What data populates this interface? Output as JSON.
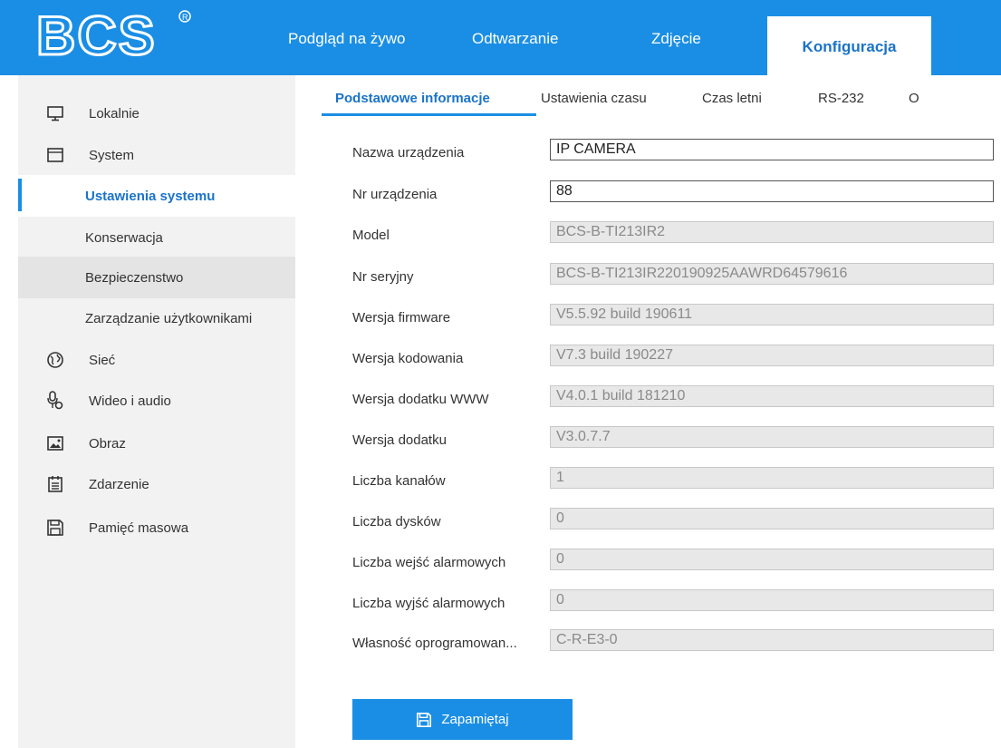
{
  "brand": {
    "logo_text": "BCS"
  },
  "nav": {
    "items": [
      "Podgląd na żywo",
      "Odtwarzanie",
      "Zdjęcie",
      "Konfiguracja"
    ],
    "active": "Konfiguracja"
  },
  "sidebar": {
    "items": [
      {
        "label": "Lokalnie",
        "icon": "monitor-icon"
      },
      {
        "label": "System",
        "icon": "system-icon"
      },
      {
        "label": "Ustawienia systemu"
      },
      {
        "label": "Konserwacja"
      },
      {
        "label": "Bezpieczenstwo"
      },
      {
        "label": "Zarządzanie użytkownikami"
      },
      {
        "label": "Sieć",
        "icon": "globe-icon"
      },
      {
        "label": "Wideo i audio",
        "icon": "microphone-icon"
      },
      {
        "label": "Obraz",
        "icon": "image-icon"
      },
      {
        "label": "Zdarzenie",
        "icon": "calendar-icon"
      },
      {
        "label": "Pamięć masowa",
        "icon": "floppy-icon"
      }
    ],
    "selected": "Ustawienia systemu"
  },
  "tabs": [
    "Podstawowe informacje",
    "Ustawienia czasu",
    "Czas letni",
    "RS-232",
    "O"
  ],
  "form": {
    "rows": [
      {
        "label": "Nazwa urządzenia",
        "value": "IP CAMERA"
      },
      {
        "label": "Nr urządzenia",
        "value": "88"
      },
      {
        "label": "Model",
        "value": "BCS-B-TI213IR2"
      },
      {
        "label": "Nr seryjny",
        "value": "BCS-B-TI213IR220190925AAWRD64579616"
      },
      {
        "label": "Wersja firmware",
        "value": "V5.5.92 build 190611"
      },
      {
        "label": "Wersja kodowania",
        "value": "V7.3 build 190227"
      },
      {
        "label": "Wersja dodatku WWW",
        "value": "V4.0.1 build 181210"
      },
      {
        "label": "Wersja dodatku",
        "value": "V3.0.7.7"
      },
      {
        "label": "Liczba kanałów",
        "value": "1"
      },
      {
        "label": "Liczba dysków",
        "value": "0"
      },
      {
        "label": "Liczba wejść alarmowych",
        "value": "0"
      },
      {
        "label": "Liczba wyjść alarmowych",
        "value": "0"
      },
      {
        "label": "Własność oprogramowan...",
        "value": "C-R-E3-0"
      }
    ]
  },
  "save_button": {
    "label": "Zapamiętaj"
  },
  "colors": {
    "accent": "#1a8ee5",
    "active_text": "#1a73c9",
    "sidebar_bg": "#f2f2f2",
    "field_bg": "#e8e8e8"
  }
}
